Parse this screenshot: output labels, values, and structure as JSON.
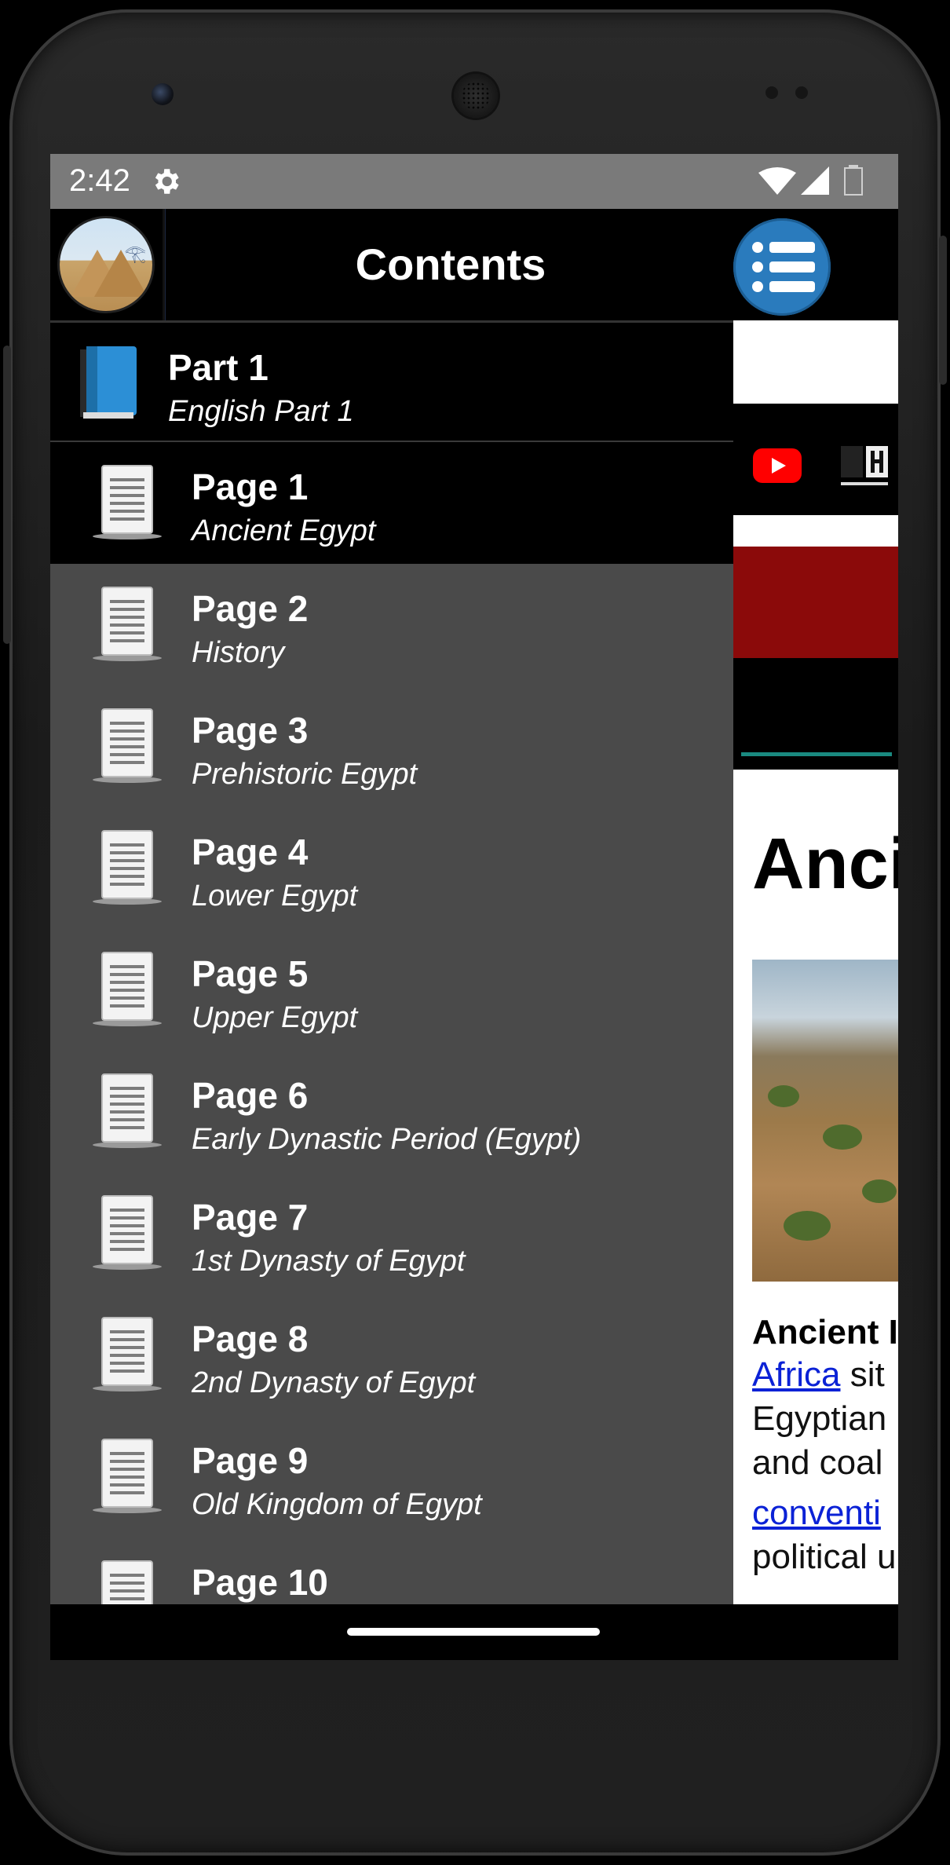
{
  "status_bar": {
    "time": "2:42",
    "icons": [
      "settings-icon",
      "wifi-icon",
      "signal-icon",
      "battery-icon"
    ]
  },
  "drawer": {
    "title": "Contents",
    "part": {
      "title": "Part 1",
      "subtitle": "English Part 1"
    },
    "pages": [
      {
        "title": "Page 1",
        "subtitle": "Ancient Egypt"
      },
      {
        "title": "Page 2",
        "subtitle": "History"
      },
      {
        "title": "Page 3",
        "subtitle": "Prehistoric Egypt"
      },
      {
        "title": "Page 4",
        "subtitle": "Lower Egypt"
      },
      {
        "title": "Page 5",
        "subtitle": "Upper Egypt"
      },
      {
        "title": "Page 6",
        "subtitle": "Early Dynastic Period (Egypt)"
      },
      {
        "title": "Page 7",
        "subtitle": "1st Dynasty of Egypt"
      },
      {
        "title": "Page 8",
        "subtitle": "2nd Dynasty of Egypt"
      },
      {
        "title": "Page 9",
        "subtitle": "Old Kingdom of Egypt"
      },
      {
        "title": "Page 10",
        "subtitle": ""
      }
    ]
  },
  "background_article": {
    "title_partial": "Anci",
    "bold_partial": "Ancient I",
    "link1": "Africa",
    "line1_rest": " sit",
    "line2": "Egyptian",
    "line3": "and coal",
    "link2": "conventi",
    "line5": "political u"
  },
  "colors": {
    "accent": "#2a7bbd",
    "banner_red": "#8b0a0a",
    "teal": "#1a8a80",
    "drawer_bg": "#4a4a4a"
  }
}
